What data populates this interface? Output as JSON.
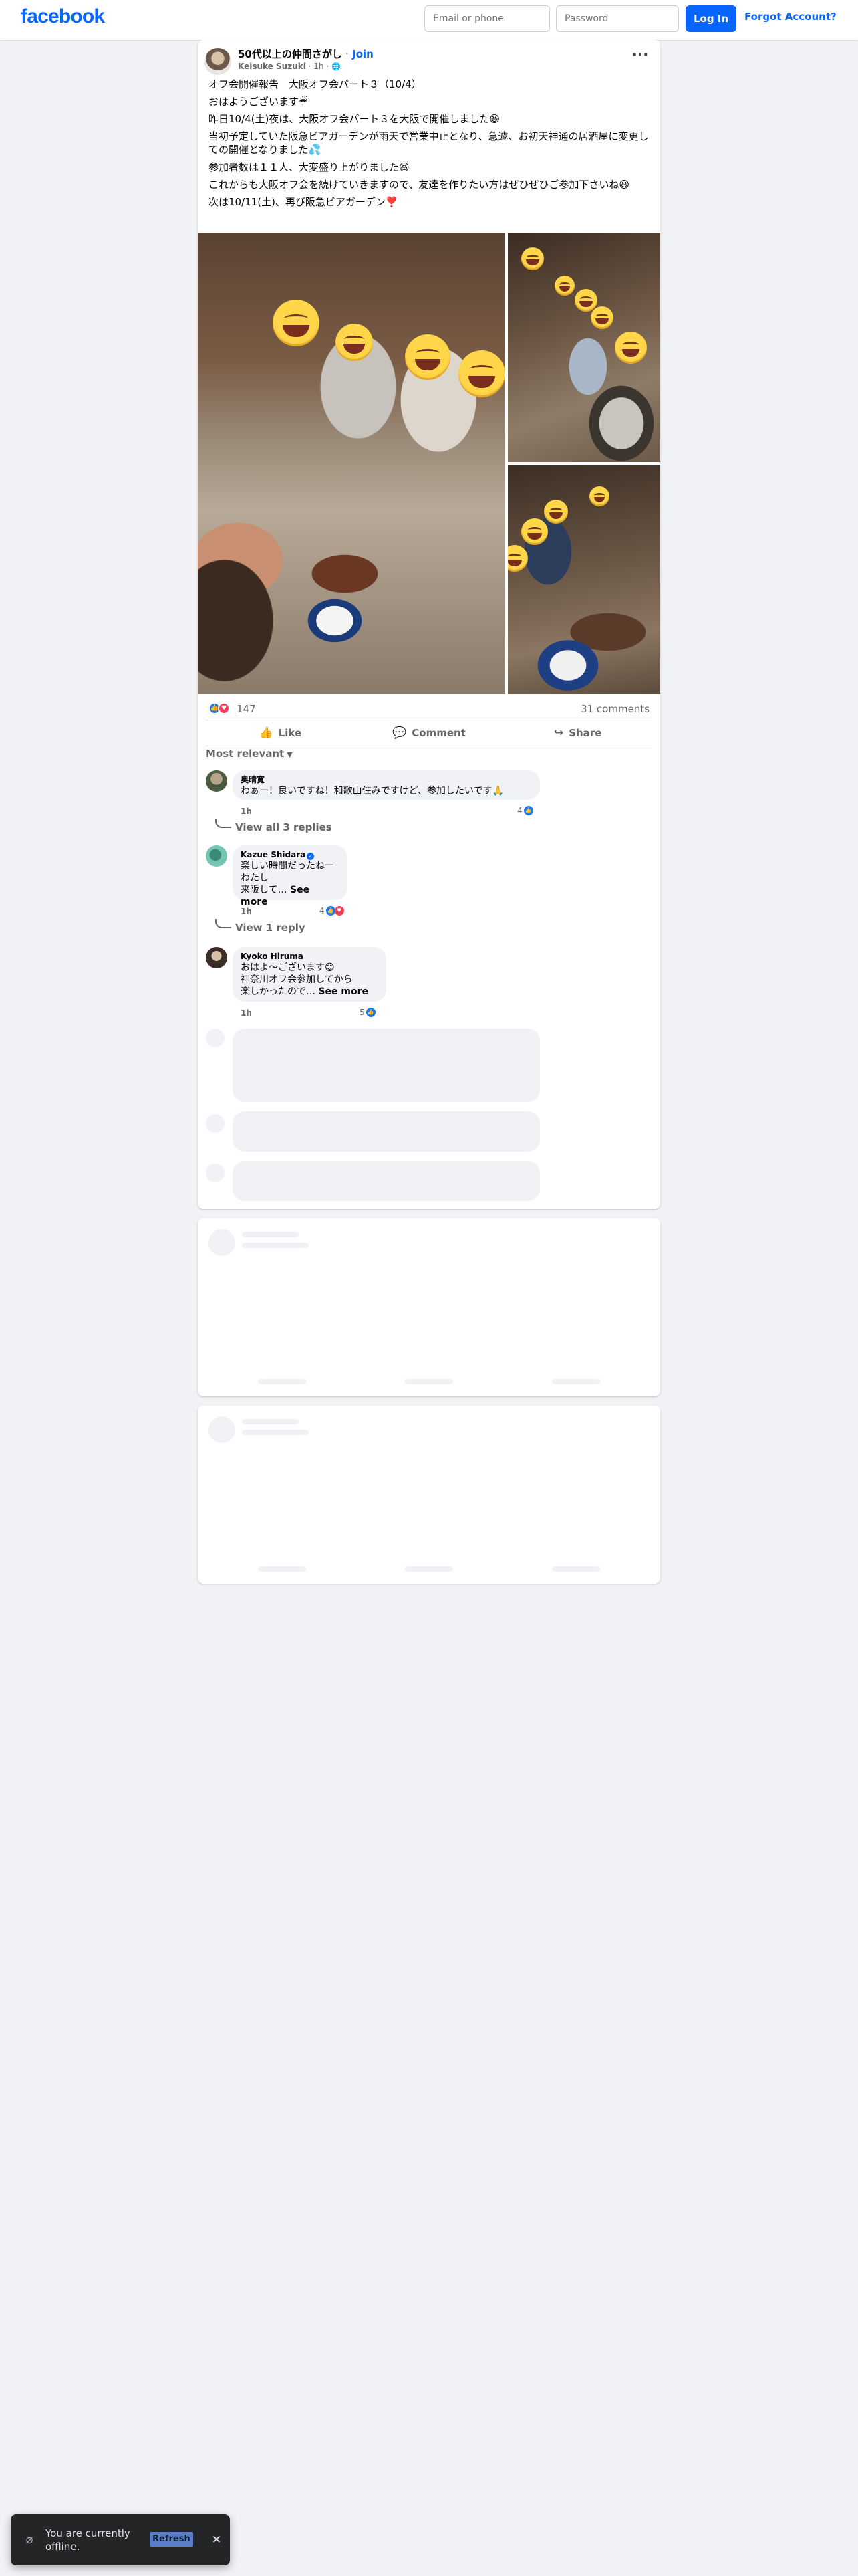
{
  "header": {
    "logo": "facebook",
    "email_placeholder": "Email or phone",
    "password_placeholder": "Password",
    "login_label": "Log In",
    "forgot_label": "Forgot Account?"
  },
  "post": {
    "group_name": "50代以上の仲間さがし",
    "separator": "·",
    "join_label": "Join",
    "author": "Keisuke Suzuki",
    "time": "1h",
    "more_icon": "more-options-icon",
    "paragraphs": [
      "オフ会開催報告　大阪オフ会パート３（10/4）",
      "おはようございます☔",
      "昨日10/4(土)夜は、大阪オフ会パート３を大阪で開催しました😆",
      "当初予定していた阪急ビアガーデンが雨天で営業中止となり、急遽、お初天神通の居酒屋に変更しての開催となりました💦",
      "参加者数は１１人、大変盛り上がりました😆",
      "これからも大阪オフ会を続けていきますので、友達を作りたい方はぜひぜひご参加下さいね😆",
      "次は10/11(土)、再び阪急ビアガーデン❣️"
    ],
    "reaction_count": "147",
    "comments_count": "31 comments",
    "actions": {
      "like": "Like",
      "comment": "Comment",
      "share": "Share"
    },
    "sort_label": "Most relevant"
  },
  "comments": [
    {
      "name": "奥晴寛",
      "text": "わぁー！良いですね！和歌山住みですけど、参加したいです🙏",
      "time": "1h",
      "reactions": "4",
      "replies_link": "View all 3 replies"
    },
    {
      "name": "Kazue Shidara",
      "verified": true,
      "lines": [
        "楽しい時間だったねー",
        "わたし",
        "来阪して…"
      ],
      "see_more": "See more",
      "time": "1h",
      "reactions": "4",
      "replies_link": "View 1 reply"
    },
    {
      "name": "Kyoko Hiruma",
      "lines": [
        "おはよ〜ございます😊",
        "神奈川オフ会参加してから",
        "楽しかったので…"
      ],
      "see_more": "See more",
      "time": "1h",
      "reactions": "5"
    }
  ],
  "toast": {
    "message": "You are currently offline.",
    "refresh_label": "Refresh",
    "close_icon": "close-icon"
  },
  "colors": {
    "brand": "#0866ff",
    "background": "#f0f2f5",
    "secondary_text": "#65676b"
  }
}
